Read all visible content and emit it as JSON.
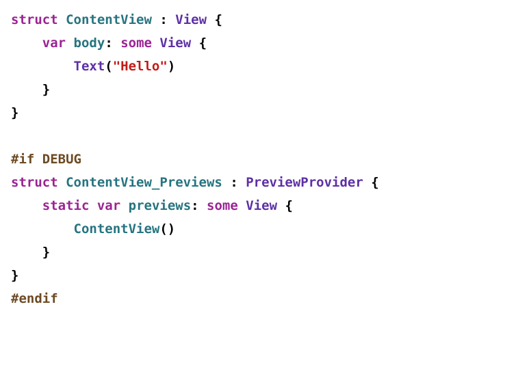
{
  "tokens": [
    [
      {
        "t": "struct",
        "c": "kw"
      },
      {
        "t": " ",
        "c": "punc"
      },
      {
        "t": "ContentView",
        "c": "type"
      },
      {
        "t": " : ",
        "c": "punc"
      },
      {
        "t": "View",
        "c": "ptype"
      },
      {
        "t": " {",
        "c": "punc"
      }
    ],
    [
      {
        "t": "    ",
        "c": "punc"
      },
      {
        "t": "var",
        "c": "kw"
      },
      {
        "t": " ",
        "c": "punc"
      },
      {
        "t": "body",
        "c": "type"
      },
      {
        "t": ": ",
        "c": "punc"
      },
      {
        "t": "some",
        "c": "kw"
      },
      {
        "t": " ",
        "c": "punc"
      },
      {
        "t": "View",
        "c": "ptype"
      },
      {
        "t": " {",
        "c": "punc"
      }
    ],
    [
      {
        "t": "        ",
        "c": "punc"
      },
      {
        "t": "Text",
        "c": "ptype"
      },
      {
        "t": "(",
        "c": "punc"
      },
      {
        "t": "\"Hello\"",
        "c": "str"
      },
      {
        "t": ")",
        "c": "punc"
      }
    ],
    [
      {
        "t": "    }",
        "c": "punc"
      }
    ],
    [
      {
        "t": "}",
        "c": "punc"
      }
    ],
    [],
    [
      {
        "t": "#if DEBUG",
        "c": "pp"
      }
    ],
    [
      {
        "t": "struct",
        "c": "kw"
      },
      {
        "t": " ",
        "c": "punc"
      },
      {
        "t": "ContentView_Previews",
        "c": "type"
      },
      {
        "t": " : ",
        "c": "punc"
      },
      {
        "t": "PreviewProvider",
        "c": "ptype"
      },
      {
        "t": " {",
        "c": "punc"
      }
    ],
    [
      {
        "t": "    ",
        "c": "punc"
      },
      {
        "t": "static",
        "c": "kw"
      },
      {
        "t": " ",
        "c": "punc"
      },
      {
        "t": "var",
        "c": "kw"
      },
      {
        "t": " ",
        "c": "punc"
      },
      {
        "t": "previews",
        "c": "type"
      },
      {
        "t": ": ",
        "c": "punc"
      },
      {
        "t": "some",
        "c": "kw"
      },
      {
        "t": " ",
        "c": "punc"
      },
      {
        "t": "View",
        "c": "ptype"
      },
      {
        "t": " {",
        "c": "punc"
      }
    ],
    [
      {
        "t": "        ",
        "c": "punc"
      },
      {
        "t": "ContentView",
        "c": "type"
      },
      {
        "t": "()",
        "c": "punc"
      }
    ],
    [
      {
        "t": "    }",
        "c": "punc"
      }
    ],
    [
      {
        "t": "}",
        "c": "punc"
      }
    ],
    [
      {
        "t": "#endif",
        "c": "pp"
      }
    ]
  ]
}
